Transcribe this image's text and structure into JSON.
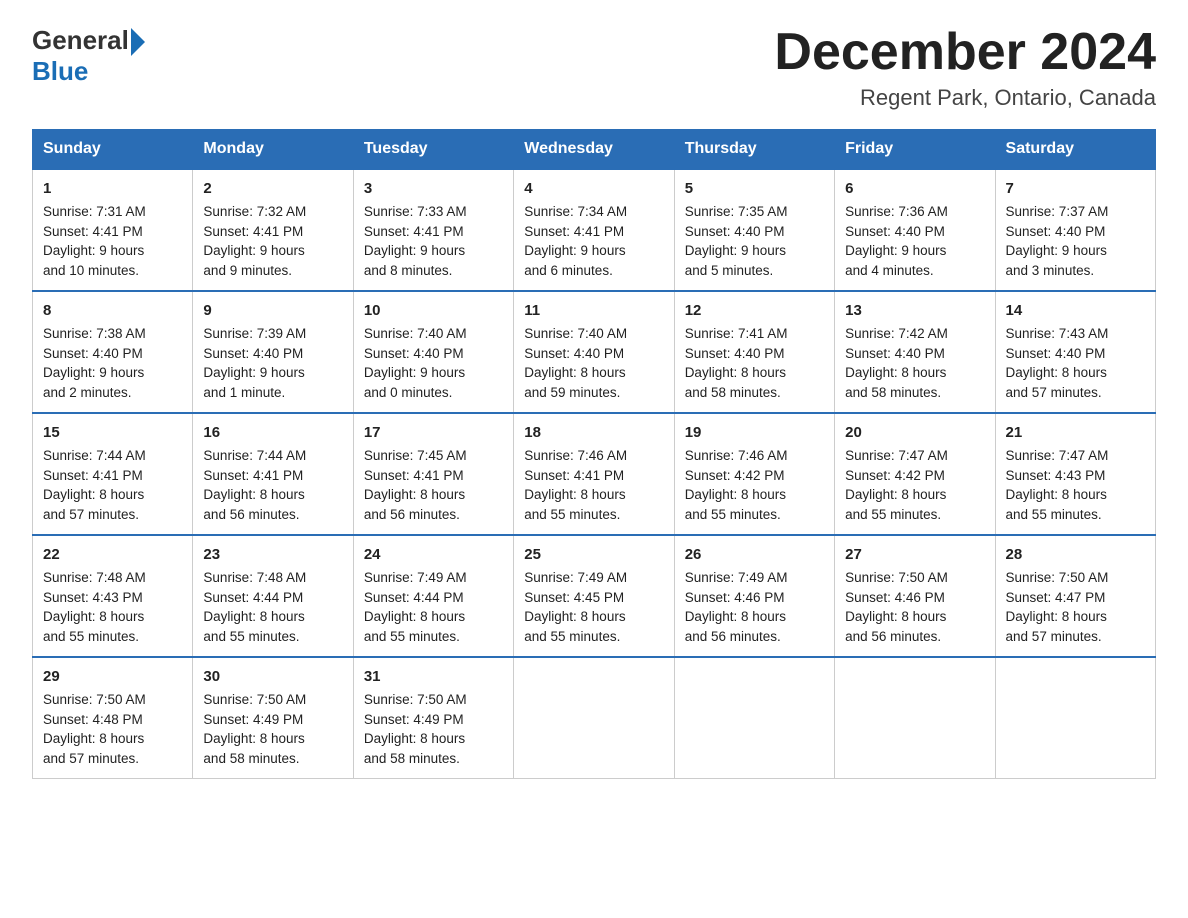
{
  "logo": {
    "general": "General",
    "triangle": "",
    "blue": "Blue"
  },
  "title": "December 2024",
  "location": "Regent Park, Ontario, Canada",
  "days_of_week": [
    "Sunday",
    "Monday",
    "Tuesday",
    "Wednesday",
    "Thursday",
    "Friday",
    "Saturday"
  ],
  "weeks": [
    [
      {
        "day": "1",
        "lines": [
          "Sunrise: 7:31 AM",
          "Sunset: 4:41 PM",
          "Daylight: 9 hours",
          "and 10 minutes."
        ]
      },
      {
        "day": "2",
        "lines": [
          "Sunrise: 7:32 AM",
          "Sunset: 4:41 PM",
          "Daylight: 9 hours",
          "and 9 minutes."
        ]
      },
      {
        "day": "3",
        "lines": [
          "Sunrise: 7:33 AM",
          "Sunset: 4:41 PM",
          "Daylight: 9 hours",
          "and 8 minutes."
        ]
      },
      {
        "day": "4",
        "lines": [
          "Sunrise: 7:34 AM",
          "Sunset: 4:41 PM",
          "Daylight: 9 hours",
          "and 6 minutes."
        ]
      },
      {
        "day": "5",
        "lines": [
          "Sunrise: 7:35 AM",
          "Sunset: 4:40 PM",
          "Daylight: 9 hours",
          "and 5 minutes."
        ]
      },
      {
        "day": "6",
        "lines": [
          "Sunrise: 7:36 AM",
          "Sunset: 4:40 PM",
          "Daylight: 9 hours",
          "and 4 minutes."
        ]
      },
      {
        "day": "7",
        "lines": [
          "Sunrise: 7:37 AM",
          "Sunset: 4:40 PM",
          "Daylight: 9 hours",
          "and 3 minutes."
        ]
      }
    ],
    [
      {
        "day": "8",
        "lines": [
          "Sunrise: 7:38 AM",
          "Sunset: 4:40 PM",
          "Daylight: 9 hours",
          "and 2 minutes."
        ]
      },
      {
        "day": "9",
        "lines": [
          "Sunrise: 7:39 AM",
          "Sunset: 4:40 PM",
          "Daylight: 9 hours",
          "and 1 minute."
        ]
      },
      {
        "day": "10",
        "lines": [
          "Sunrise: 7:40 AM",
          "Sunset: 4:40 PM",
          "Daylight: 9 hours",
          "and 0 minutes."
        ]
      },
      {
        "day": "11",
        "lines": [
          "Sunrise: 7:40 AM",
          "Sunset: 4:40 PM",
          "Daylight: 8 hours",
          "and 59 minutes."
        ]
      },
      {
        "day": "12",
        "lines": [
          "Sunrise: 7:41 AM",
          "Sunset: 4:40 PM",
          "Daylight: 8 hours",
          "and 58 minutes."
        ]
      },
      {
        "day": "13",
        "lines": [
          "Sunrise: 7:42 AM",
          "Sunset: 4:40 PM",
          "Daylight: 8 hours",
          "and 58 minutes."
        ]
      },
      {
        "day": "14",
        "lines": [
          "Sunrise: 7:43 AM",
          "Sunset: 4:40 PM",
          "Daylight: 8 hours",
          "and 57 minutes."
        ]
      }
    ],
    [
      {
        "day": "15",
        "lines": [
          "Sunrise: 7:44 AM",
          "Sunset: 4:41 PM",
          "Daylight: 8 hours",
          "and 57 minutes."
        ]
      },
      {
        "day": "16",
        "lines": [
          "Sunrise: 7:44 AM",
          "Sunset: 4:41 PM",
          "Daylight: 8 hours",
          "and 56 minutes."
        ]
      },
      {
        "day": "17",
        "lines": [
          "Sunrise: 7:45 AM",
          "Sunset: 4:41 PM",
          "Daylight: 8 hours",
          "and 56 minutes."
        ]
      },
      {
        "day": "18",
        "lines": [
          "Sunrise: 7:46 AM",
          "Sunset: 4:41 PM",
          "Daylight: 8 hours",
          "and 55 minutes."
        ]
      },
      {
        "day": "19",
        "lines": [
          "Sunrise: 7:46 AM",
          "Sunset: 4:42 PM",
          "Daylight: 8 hours",
          "and 55 minutes."
        ]
      },
      {
        "day": "20",
        "lines": [
          "Sunrise: 7:47 AM",
          "Sunset: 4:42 PM",
          "Daylight: 8 hours",
          "and 55 minutes."
        ]
      },
      {
        "day": "21",
        "lines": [
          "Sunrise: 7:47 AM",
          "Sunset: 4:43 PM",
          "Daylight: 8 hours",
          "and 55 minutes."
        ]
      }
    ],
    [
      {
        "day": "22",
        "lines": [
          "Sunrise: 7:48 AM",
          "Sunset: 4:43 PM",
          "Daylight: 8 hours",
          "and 55 minutes."
        ]
      },
      {
        "day": "23",
        "lines": [
          "Sunrise: 7:48 AM",
          "Sunset: 4:44 PM",
          "Daylight: 8 hours",
          "and 55 minutes."
        ]
      },
      {
        "day": "24",
        "lines": [
          "Sunrise: 7:49 AM",
          "Sunset: 4:44 PM",
          "Daylight: 8 hours",
          "and 55 minutes."
        ]
      },
      {
        "day": "25",
        "lines": [
          "Sunrise: 7:49 AM",
          "Sunset: 4:45 PM",
          "Daylight: 8 hours",
          "and 55 minutes."
        ]
      },
      {
        "day": "26",
        "lines": [
          "Sunrise: 7:49 AM",
          "Sunset: 4:46 PM",
          "Daylight: 8 hours",
          "and 56 minutes."
        ]
      },
      {
        "day": "27",
        "lines": [
          "Sunrise: 7:50 AM",
          "Sunset: 4:46 PM",
          "Daylight: 8 hours",
          "and 56 minutes."
        ]
      },
      {
        "day": "28",
        "lines": [
          "Sunrise: 7:50 AM",
          "Sunset: 4:47 PM",
          "Daylight: 8 hours",
          "and 57 minutes."
        ]
      }
    ],
    [
      {
        "day": "29",
        "lines": [
          "Sunrise: 7:50 AM",
          "Sunset: 4:48 PM",
          "Daylight: 8 hours",
          "and 57 minutes."
        ]
      },
      {
        "day": "30",
        "lines": [
          "Sunrise: 7:50 AM",
          "Sunset: 4:49 PM",
          "Daylight: 8 hours",
          "and 58 minutes."
        ]
      },
      {
        "day": "31",
        "lines": [
          "Sunrise: 7:50 AM",
          "Sunset: 4:49 PM",
          "Daylight: 8 hours",
          "and 58 minutes."
        ]
      },
      {
        "day": "",
        "lines": []
      },
      {
        "day": "",
        "lines": []
      },
      {
        "day": "",
        "lines": []
      },
      {
        "day": "",
        "lines": []
      }
    ]
  ]
}
